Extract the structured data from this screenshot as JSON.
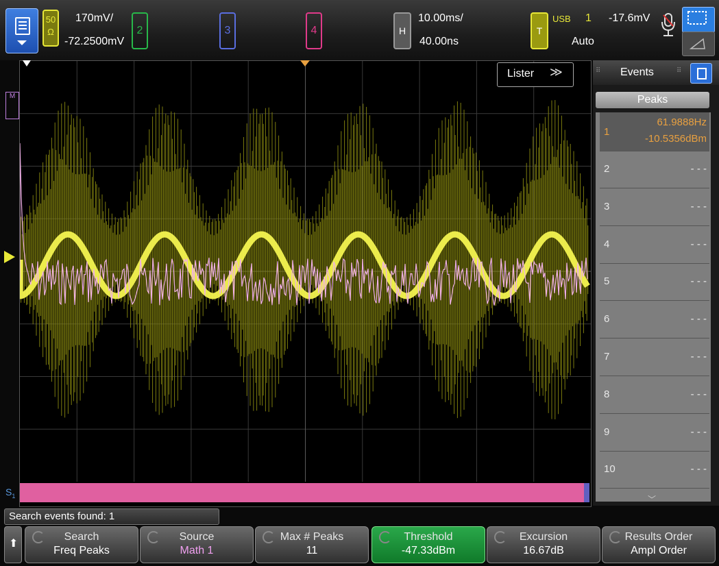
{
  "colors": {
    "ch1": "#e8e838",
    "ch2": "#28b84a",
    "ch3": "#5a6ee0",
    "ch4": "#e03a8a",
    "math": "#e8a0e8",
    "accent": "#2a7ee0"
  },
  "status": {
    "ch1_impedance_top": "50",
    "ch1_impedance_bottom": "Ω",
    "ch1_scale": "170mV/",
    "ch1_offset": "-72.2500mV",
    "ch2_label": "2",
    "ch3_label": "3",
    "ch4_label": "4",
    "horizontal_badge": "H",
    "time_scale": "10.00ms/",
    "time_delay": "40.00ns",
    "trigger_badge": "T",
    "trigger_source": "USB",
    "trigger_channel": "1",
    "trigger_level": "-17.6mV",
    "trigger_mode": "Auto"
  },
  "screen": {
    "lister_label": "Lister",
    "search_line_label": "S",
    "search_line_sub": "1",
    "math_marker": "M"
  },
  "panel": {
    "title": "Events",
    "tab": "Peaks",
    "events": [
      {
        "num": "1",
        "value1": "61.9888Hz",
        "value2": "-10.5356dBm"
      },
      {
        "num": "2",
        "value1": "- - -"
      },
      {
        "num": "3",
        "value1": "- - -"
      },
      {
        "num": "4",
        "value1": "- - -"
      },
      {
        "num": "5",
        "value1": "- - -"
      },
      {
        "num": "6",
        "value1": "- - -"
      },
      {
        "num": "7",
        "value1": "- - -"
      },
      {
        "num": "8",
        "value1": "- - -"
      },
      {
        "num": "9",
        "value1": "- - -"
      },
      {
        "num": "10",
        "value1": "- - -"
      }
    ]
  },
  "footer": {
    "search_status": "Search events found: 1",
    "softkeys": [
      {
        "label": "Search",
        "value": "Freq Peaks"
      },
      {
        "label": "Source",
        "value": "Math 1"
      },
      {
        "label": "Max # Peaks",
        "value": "11"
      },
      {
        "label": "Threshold",
        "value": "-47.33dBm"
      },
      {
        "label": "Excursion",
        "value": "16.67dB"
      },
      {
        "label": "Results Order",
        "value": "Ampl Order"
      }
    ]
  }
}
